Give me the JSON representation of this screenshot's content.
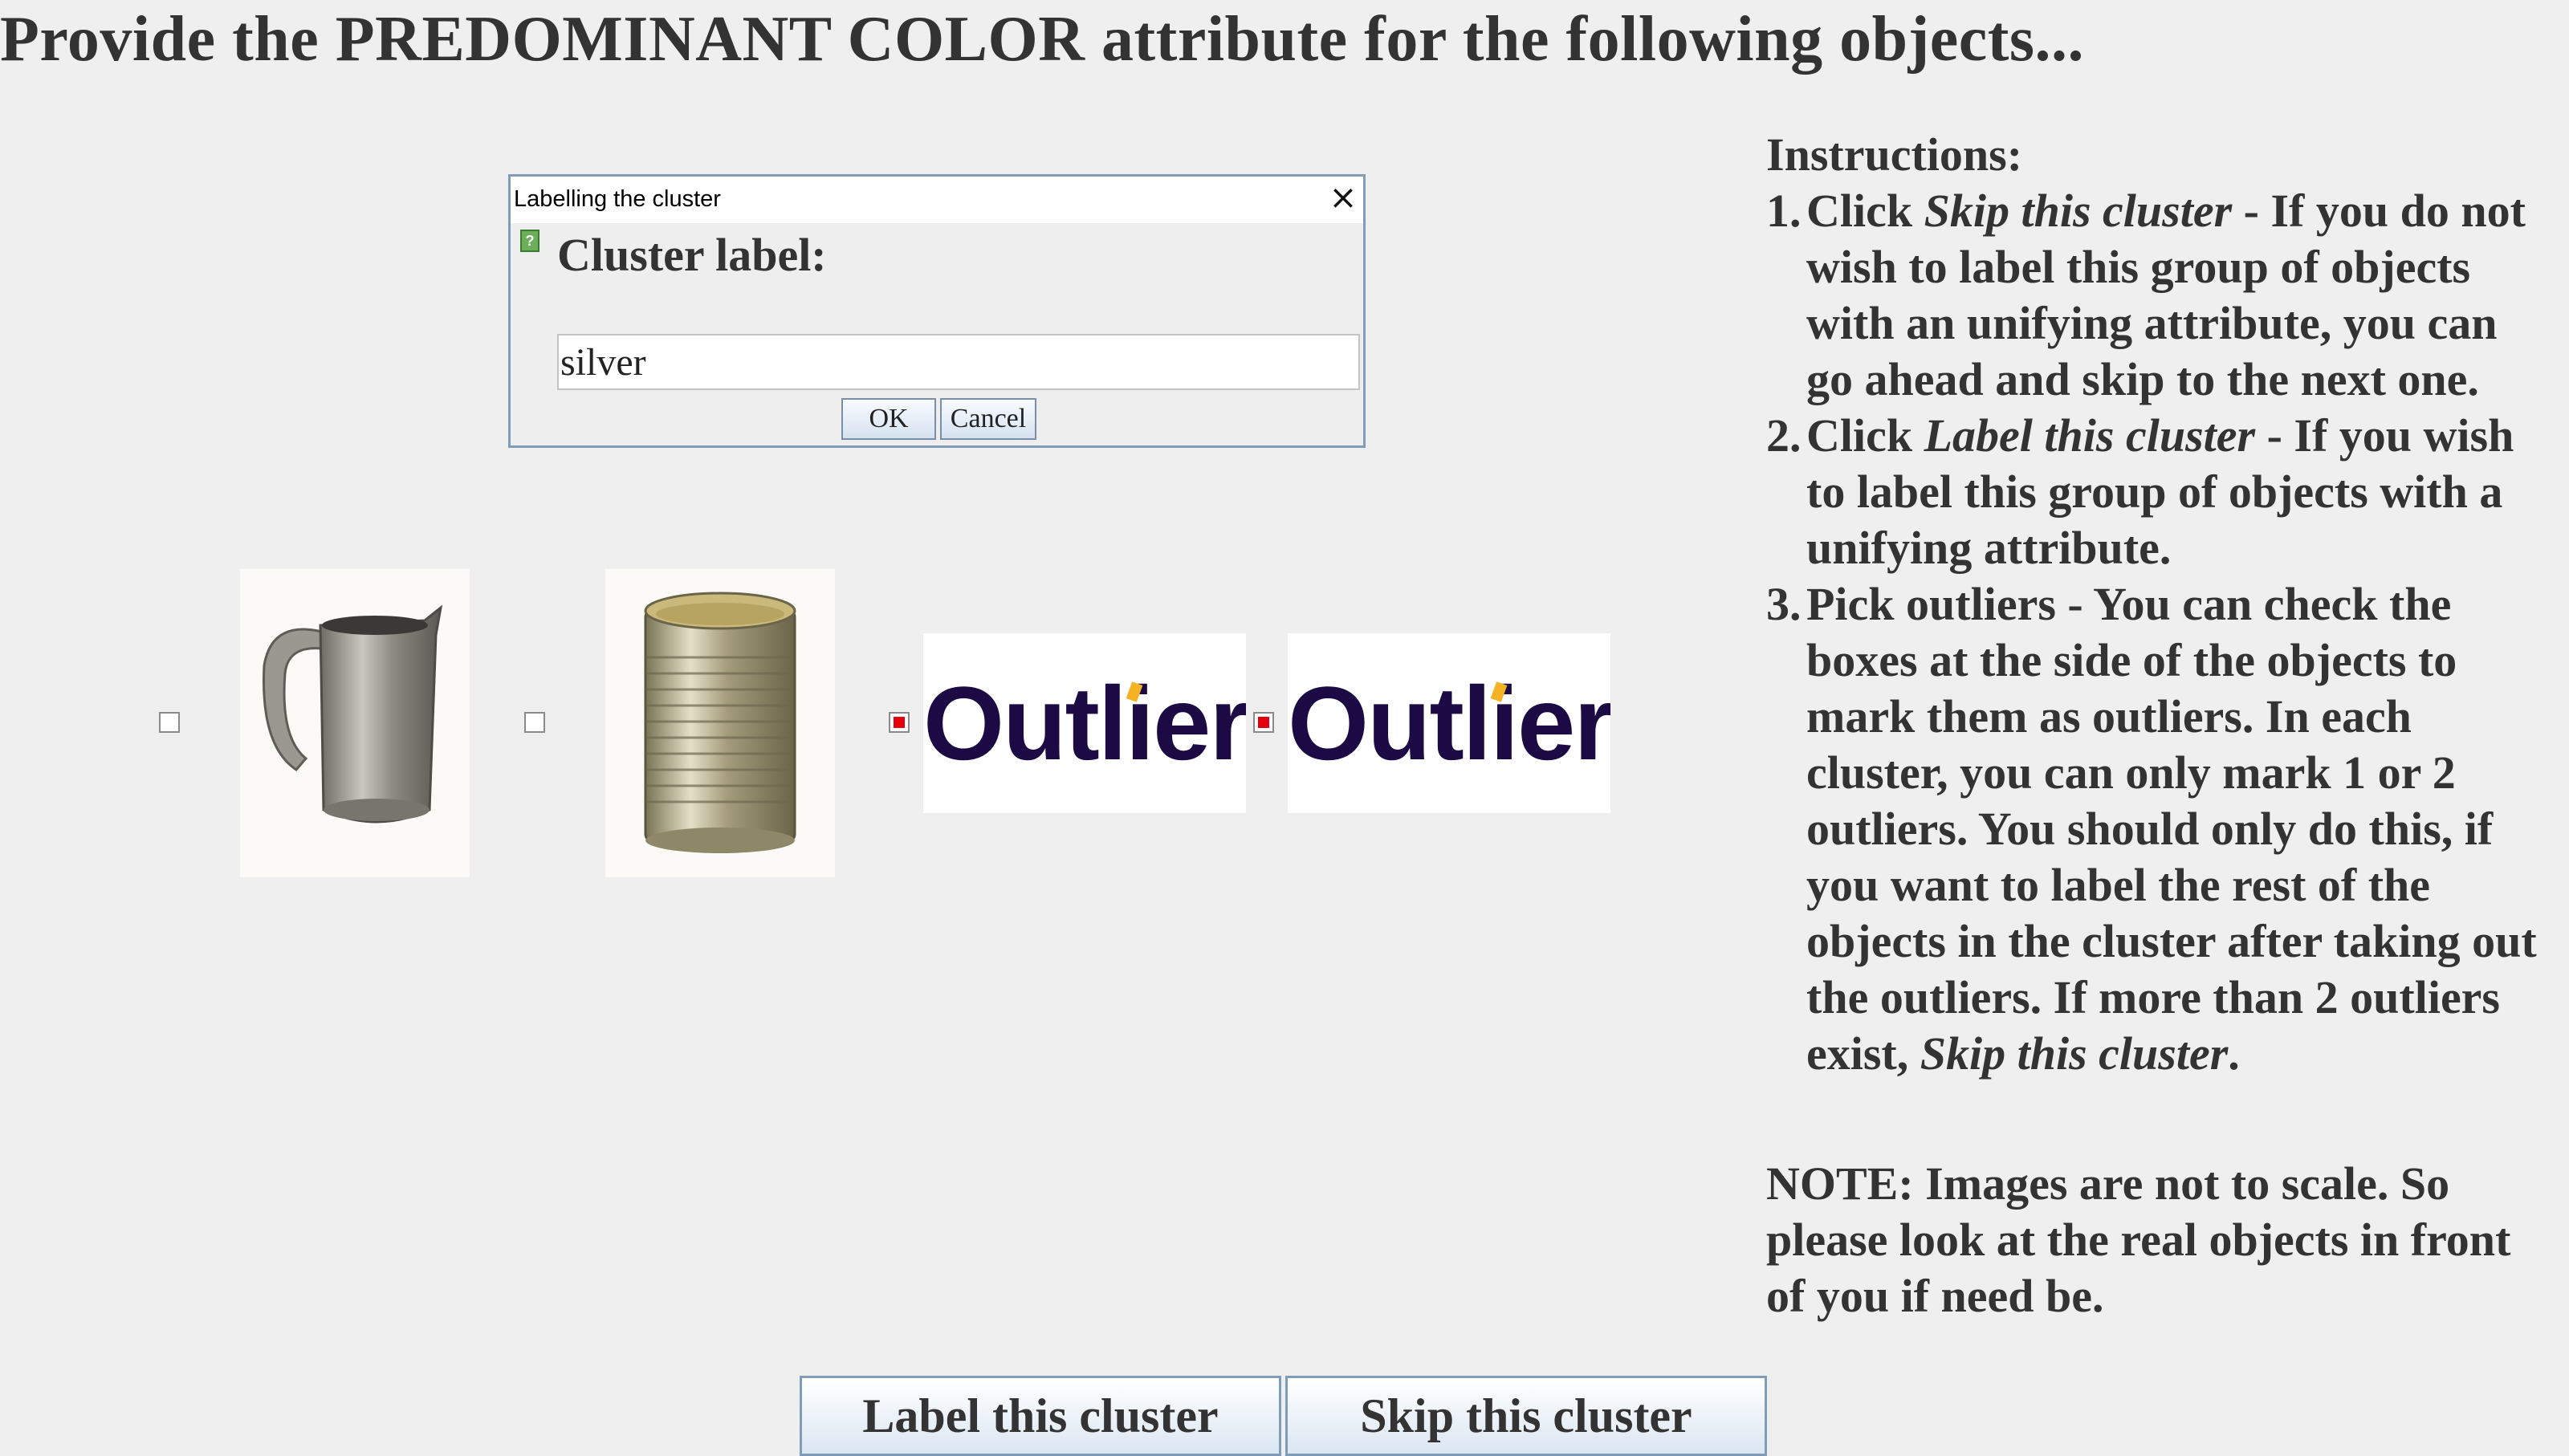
{
  "header": {
    "title": "Provide the PREDOMINANT COLOR attribute for the following objects..."
  },
  "dialog": {
    "title": "Labelling the cluster",
    "close_glyph": "×",
    "help_icon": "question-icon",
    "heading": "Cluster label:",
    "input_value": "silver",
    "ok_label": "OK",
    "cancel_label": "Cancel"
  },
  "objects": [
    {
      "kind": "photo",
      "icon": "metal-pitcher",
      "checked": false
    },
    {
      "kind": "photo",
      "icon": "tin-can",
      "checked": false
    },
    {
      "kind": "outlier",
      "text": "Outlier",
      "checked": true
    },
    {
      "kind": "outlier",
      "text": "Outlier",
      "checked": true
    }
  ],
  "instructions": {
    "heading": "Instructions:",
    "items": [
      {
        "num": "1.",
        "lead": "Click ",
        "em": "Skip this cluster",
        "rest": " - If you do not wish to label this group of objects with an unifying attribute, you can go ahead and skip to the next one."
      },
      {
        "num": "2.",
        "lead": "Click ",
        "em": "Label this cluster",
        "rest": " - If you wish to label this group of objects with a unifying attribute."
      },
      {
        "num": "3.",
        "lead": "Pick outliers - You can check the boxes at the side of the objects to mark them as outliers. In each cluster, you can only mark 1 or 2 outliers. You should only do this, if you want to label the rest of the objects in the cluster after taking out the outliers. If more than 2 outliers exist, ",
        "em": "Skip this cluster",
        "rest": "."
      }
    ],
    "note": "NOTE: Images are not to scale. So please look at the real objects in front of you if need be."
  },
  "buttons": {
    "label_cluster": "Label this cluster",
    "skip_cluster": "Skip this cluster"
  },
  "colors": {
    "background": "#efefef",
    "text": "#333333",
    "outlier_text": "#1c0a45",
    "outlier_dot": "#f5b324",
    "checked_mark": "#e3000f",
    "border_accent": "#7f9db9"
  }
}
